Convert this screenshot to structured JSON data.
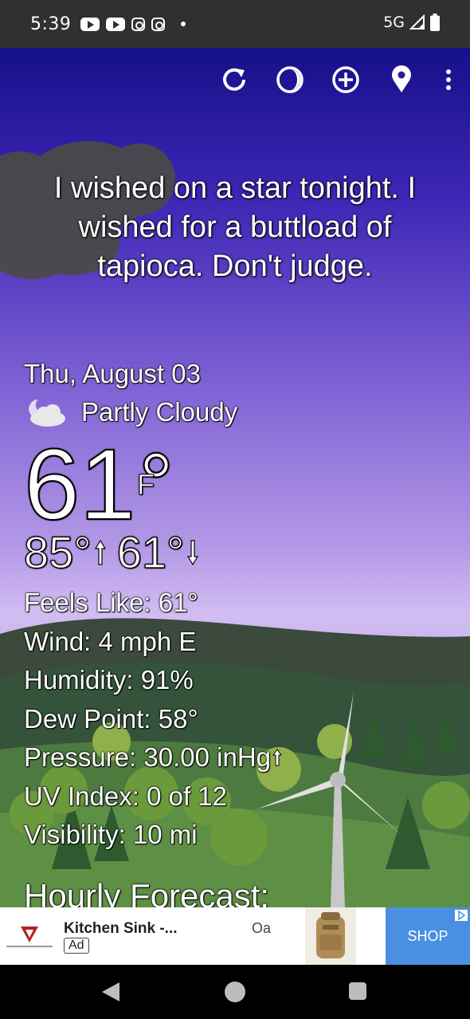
{
  "status_bar": {
    "time": "5:39",
    "network": "5G",
    "icons": [
      "youtube-icon",
      "youtube-icon",
      "instagram-icon",
      "instagram-icon",
      "notification-dot",
      "signal-icon",
      "battery-icon"
    ]
  },
  "toolbar": {
    "icons": [
      "refresh-icon",
      "theme-icon",
      "add-location-icon",
      "location-pin-icon",
      "more-options-icon"
    ]
  },
  "quote": "I wished on a star tonight. I wished for a buttload of tapioca. Don't judge.",
  "weather": {
    "date": "Thu, August 03",
    "condition": "Partly Cloudy",
    "condition_icon": "partly-cloudy-night-icon",
    "temperature": "61",
    "degree_symbol": "°",
    "unit": "F",
    "high": "85°",
    "low": "61°",
    "details": {
      "feels_like": "Feels Like:  61°",
      "wind": "Wind:  4 mph E",
      "humidity": "Humidity:  91%",
      "dew_point": "Dew Point:  58°",
      "pressure": "Pressure:  30.00 inHg",
      "uv_index": "UV Index:  0 of 12",
      "visibility": "Visibility:  10 mi"
    },
    "pressure_trend_icon": "arrow-up-icon"
  },
  "hourly_heading": "Hourly Forecast:",
  "ad": {
    "title": "Kitchen Sink -...",
    "badge": "Ad",
    "extra": "Oa",
    "cta": "SHOP",
    "choice_icon": "adchoices-icon"
  },
  "colors": {
    "sky_top": "#16108a",
    "sky_bottom": "#d2bdf2",
    "status_bar": "#303030",
    "ad_cta": "#4a90e2"
  }
}
